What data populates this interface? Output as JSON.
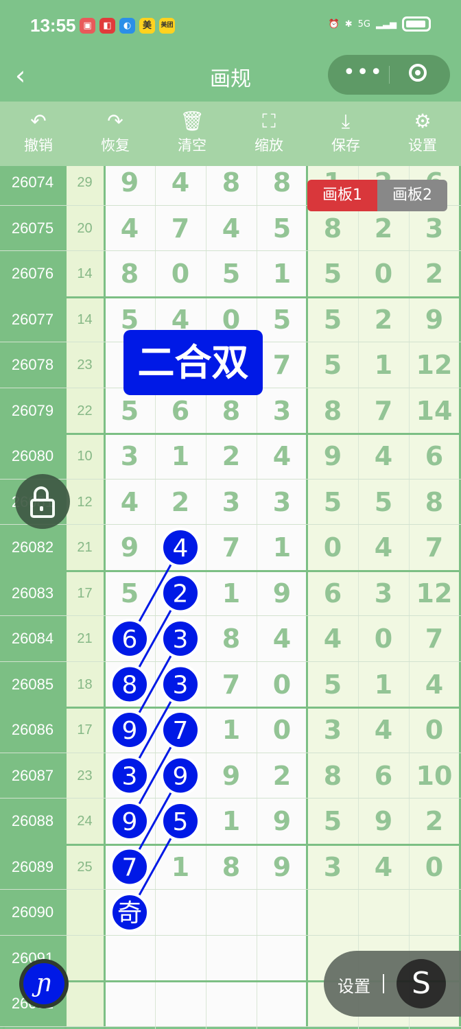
{
  "status_bar": {
    "time": "13:55",
    "network": "5G",
    "app_icons": [
      "red-app-icon",
      "red-app-icon",
      "blue-app-icon",
      "美",
      "美团"
    ]
  },
  "nav": {
    "back_icon": "‹",
    "title": "画规"
  },
  "toolbar": [
    {
      "icon": "↶",
      "label": "撤销",
      "name": "undo"
    },
    {
      "icon": "↷",
      "label": "恢复",
      "name": "redo"
    },
    {
      "icon": "🗑",
      "label": "清空",
      "name": "clear"
    },
    {
      "icon": "⛶",
      "label": "缩放",
      "name": "zoom"
    },
    {
      "icon": "⤓",
      "label": "保存",
      "name": "save"
    },
    {
      "icon": "⚙",
      "label": "设置",
      "name": "settings"
    }
  ],
  "board_tabs": [
    "画板1",
    "画板2"
  ],
  "overlay_label": "二合双",
  "rows": [
    {
      "issue": "26074",
      "sum": "29",
      "digits": [
        "9",
        "4",
        "8",
        "8"
      ],
      "extra": [
        "1",
        "2",
        "6"
      ]
    },
    {
      "issue": "26075",
      "sum": "20",
      "digits": [
        "4",
        "7",
        "4",
        "5"
      ],
      "extra": [
        "8",
        "2",
        "3"
      ]
    },
    {
      "issue": "26076",
      "sum": "14",
      "digits": [
        "8",
        "0",
        "5",
        "1"
      ],
      "extra": [
        "5",
        "0",
        "2"
      ]
    },
    {
      "issue": "26077",
      "sum": "14",
      "digits": [
        "5",
        "4",
        "0",
        "5"
      ],
      "extra": [
        "5",
        "2",
        "9"
      ]
    },
    {
      "issue": "26078",
      "sum": "23",
      "digits": [
        "",
        "",
        "",
        "7"
      ],
      "extra": [
        "5",
        "1",
        "12"
      ]
    },
    {
      "issue": "26079",
      "sum": "22",
      "digits": [
        "5",
        "6",
        "8",
        "3"
      ],
      "extra": [
        "8",
        "7",
        "14"
      ]
    },
    {
      "issue": "26080",
      "sum": "10",
      "digits": [
        "3",
        "1",
        "2",
        "4"
      ],
      "extra": [
        "9",
        "4",
        "6"
      ]
    },
    {
      "issue": "26081",
      "sum": "12",
      "digits": [
        "4",
        "2",
        "3",
        "3"
      ],
      "extra": [
        "5",
        "5",
        "8"
      ]
    },
    {
      "issue": "26082",
      "sum": "21",
      "digits": [
        "9",
        "4",
        "7",
        "1"
      ],
      "extra": [
        "0",
        "4",
        "7"
      ]
    },
    {
      "issue": "26083",
      "sum": "17",
      "digits": [
        "5",
        "2",
        "1",
        "9"
      ],
      "extra": [
        "6",
        "3",
        "12"
      ]
    },
    {
      "issue": "26084",
      "sum": "21",
      "digits": [
        "6",
        "3",
        "8",
        "4"
      ],
      "extra": [
        "4",
        "0",
        "7"
      ]
    },
    {
      "issue": "26085",
      "sum": "18",
      "digits": [
        "8",
        "3",
        "7",
        "0"
      ],
      "extra": [
        "5",
        "1",
        "4"
      ]
    },
    {
      "issue": "26086",
      "sum": "17",
      "digits": [
        "9",
        "7",
        "1",
        "0"
      ],
      "extra": [
        "3",
        "4",
        "0"
      ]
    },
    {
      "issue": "26087",
      "sum": "23",
      "digits": [
        "3",
        "9",
        "9",
        "2"
      ],
      "extra": [
        "8",
        "6",
        "10"
      ]
    },
    {
      "issue": "26088",
      "sum": "24",
      "digits": [
        "9",
        "5",
        "1",
        "9"
      ],
      "extra": [
        "5",
        "9",
        "2"
      ]
    },
    {
      "issue": "26089",
      "sum": "25",
      "digits": [
        "7",
        "1",
        "8",
        "9"
      ],
      "extra": [
        "3",
        "4",
        "0"
      ]
    },
    {
      "issue": "26090",
      "sum": "",
      "digits": [
        "奇",
        "",
        "",
        ""
      ],
      "extra": [
        "",
        "",
        ""
      ]
    },
    {
      "issue": "26091",
      "sum": "",
      "digits": [
        "",
        "",
        "",
        ""
      ],
      "extra": [
        "",
        "",
        ""
      ]
    },
    {
      "issue": "26092",
      "sum": "",
      "digits": [
        "",
        "",
        "",
        ""
      ],
      "extra": [
        "",
        "",
        ""
      ]
    }
  ],
  "marked": {
    "col0": [
      "6",
      "8",
      "9",
      "3",
      "9",
      "7",
      "奇"
    ],
    "col1": [
      "4",
      "2",
      "3",
      "3",
      "7",
      "9",
      "5"
    ]
  },
  "floating": {
    "settings_label": "设置",
    "s_icon": "S",
    "pen_icon": "pen-icon",
    "lock_icon": "lock-icon"
  },
  "colors": {
    "header_green": "#7ec38a",
    "issue_green": "#7cbf84",
    "digit_green": "#93c495",
    "marker_blue": "#0019e6",
    "tab_red": "#d9373b"
  }
}
